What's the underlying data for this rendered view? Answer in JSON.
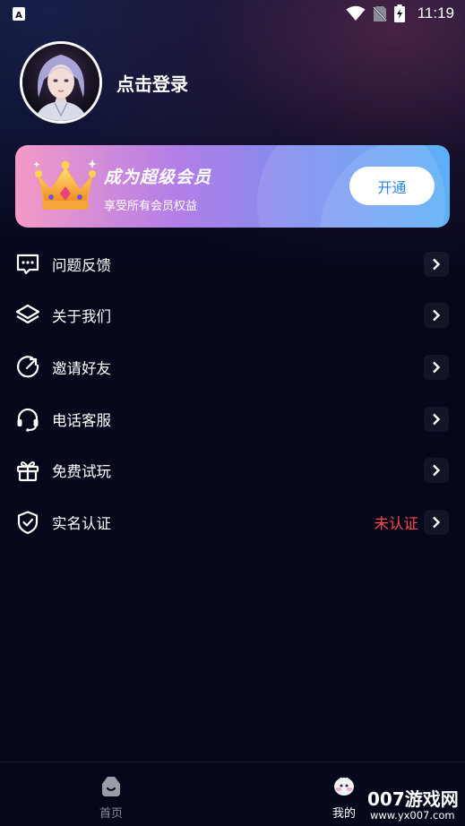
{
  "status_bar": {
    "time": "11:19"
  },
  "profile": {
    "login_text": "点击登录"
  },
  "vip": {
    "title": "成为超级会员",
    "subtitle": "享受所有会员权益",
    "button": "开通"
  },
  "menu": {
    "items": [
      {
        "label": "问题反馈",
        "icon": "chat-icon"
      },
      {
        "label": "关于我们",
        "icon": "layers-icon"
      },
      {
        "label": "邀请好友",
        "icon": "share-circle-icon"
      },
      {
        "label": "电话客服",
        "icon": "headset-icon"
      },
      {
        "label": "免费试玩",
        "icon": "gift-icon"
      },
      {
        "label": "实名认证",
        "icon": "shield-icon",
        "status": "未认证"
      }
    ]
  },
  "tabs": {
    "home": "首页",
    "mine": "我的"
  },
  "watermark": {
    "main": "007游戏网",
    "sub": "www.yx007.com"
  },
  "colors": {
    "background": "#05071a",
    "accent_blue": "#2a84e8",
    "status_red": "#ff4a4a"
  }
}
